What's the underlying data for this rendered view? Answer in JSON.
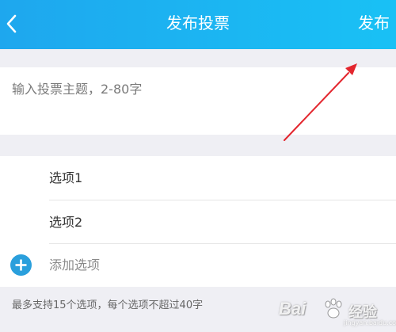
{
  "header": {
    "title": "发布投票",
    "publish_label": "发布"
  },
  "topic": {
    "placeholder": "输入投票主题，2-80字"
  },
  "options": [
    {
      "placeholder": "选项1"
    },
    {
      "placeholder": "选项2"
    }
  ],
  "add_option_label": "添加选项",
  "hint": "最多支持15个选项，每个选项不超过40字",
  "watermark": {
    "brand": "Bai",
    "cn": "经验",
    "url": "jingyan.baidu.com"
  },
  "colors": {
    "header_start": "#1ea7ee",
    "header_end": "#19c1f5",
    "accent": "#2a9fdc",
    "arrow": "#e3262e"
  },
  "icons": {
    "back": "chevron-left-icon",
    "add": "plus-circle-icon"
  }
}
